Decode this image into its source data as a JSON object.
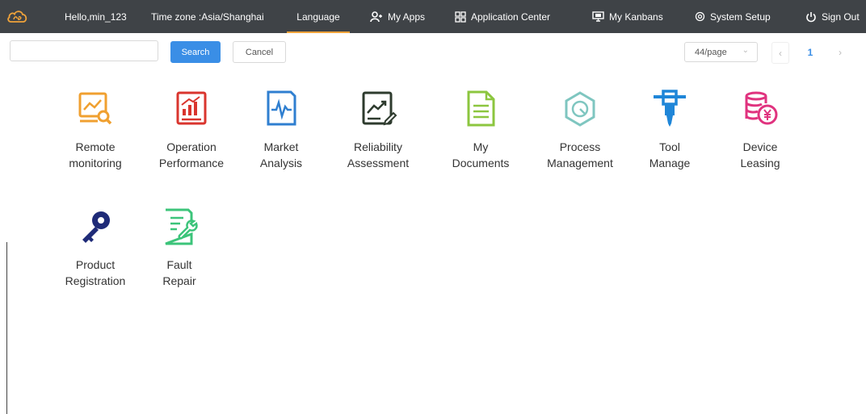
{
  "topbar": {
    "greeting": "Hello,min_123",
    "timezone": "Time zone :Asia/Shanghai",
    "language": "Language",
    "my_apps": "My Apps",
    "application_center": "Application Center",
    "my_kanbans": "My Kanbans",
    "system_setup": "System Setup",
    "sign_out": "Sign Out"
  },
  "toolbar": {
    "search_value": "",
    "search_placeholder": "",
    "search_button": "Search",
    "cancel_button": "Cancel"
  },
  "pagination": {
    "page_size": "44/page",
    "current_page": "1",
    "prev": "‹",
    "next": "›",
    "dropdown": "⌄"
  },
  "apps": [
    {
      "line1": "Remote",
      "line2": "monitoring",
      "icon": "monitor-chart-icon",
      "color": "#f0a030"
    },
    {
      "line1": "Operation",
      "line2": "Performance",
      "icon": "bar-chart-icon",
      "color": "#d9352e"
    },
    {
      "line1": "Market",
      "line2": "Analysis",
      "icon": "pulse-chart-icon",
      "color": "#2f7fd0"
    },
    {
      "line1": "Reliability",
      "line2": "Assessment",
      "icon": "trend-check-icon",
      "color": "#2e3b2e"
    },
    {
      "line1": "My",
      "line2": "Documents",
      "icon": "document-icon",
      "color": "#8cc63f"
    },
    {
      "line1": "Process",
      "line2": "Management",
      "icon": "hexagon-process-icon",
      "color": "#7fc6c0"
    },
    {
      "line1": "Tool",
      "line2": "Manage",
      "icon": "drill-tool-icon",
      "color": "#1f86d8"
    },
    {
      "line1": "Device",
      "line2": "Leasing",
      "icon": "coins-yen-icon",
      "color": "#e0337f"
    },
    {
      "line1": "Product",
      "line2": "Registration",
      "icon": "key-icon",
      "color": "#1f2b78"
    },
    {
      "line1": "Fault",
      "line2": "Repair",
      "icon": "wrench-document-icon",
      "color": "#3cc47a"
    }
  ]
}
